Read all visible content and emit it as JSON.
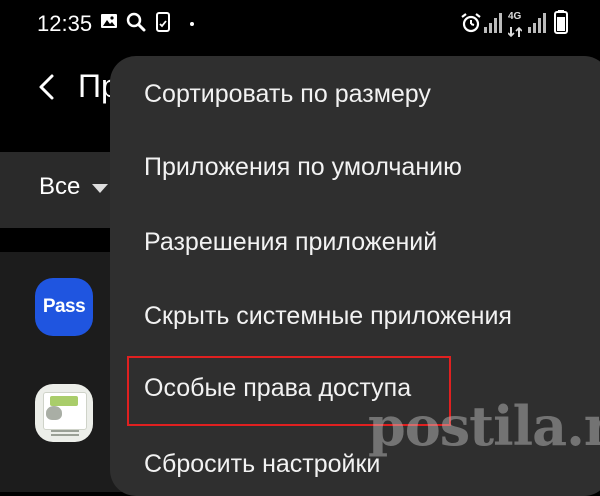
{
  "status_bar": {
    "time": "12:35",
    "network_label": "4G",
    "left_icons": [
      "image-icon",
      "search-icon",
      "screenshot-icon",
      "dot-icon"
    ],
    "right_icons": [
      "alarm-icon",
      "signal-icon",
      "4g-icon",
      "signal-icon",
      "battery-icon"
    ]
  },
  "screen": {
    "title": "Пр",
    "back_icon": "back-arrow-icon",
    "filter": {
      "label": "Все",
      "caret_icon": "caret-down-icon"
    },
    "apps": [
      {
        "icon": "pass-app-icon",
        "icon_text": "Pass",
        "color": "#1f55e0"
      },
      {
        "icon": "notes-app-icon"
      }
    ]
  },
  "menu": {
    "items": [
      {
        "label": "Сортировать по размеру"
      },
      {
        "label": "Приложения по умолчанию"
      },
      {
        "label": "Разрешения приложений"
      },
      {
        "label": "Скрыть системные приложения"
      },
      {
        "label": "Особые права доступа",
        "highlighted": true
      },
      {
        "label": "Сбросить настройки"
      }
    ],
    "highlight_color": "#e02020",
    "background": "#2f2f2f"
  },
  "watermark": {
    "text": "postila.ru"
  }
}
